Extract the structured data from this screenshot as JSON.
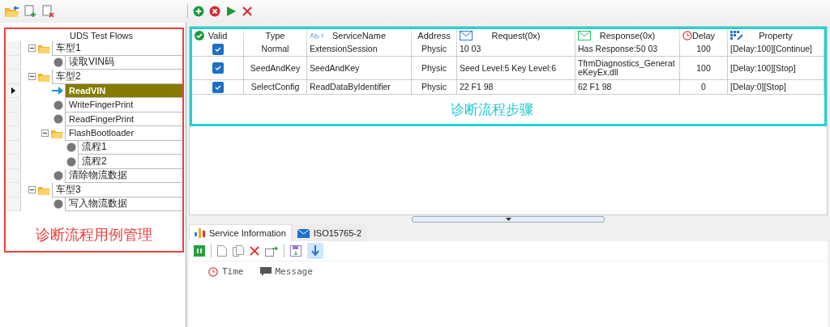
{
  "left_panel": {
    "tree": {
      "title": "UDS Test Flows",
      "nodes": [
        {
          "kind": "folder",
          "label": "车型1",
          "expanded": true,
          "selected": false,
          "children": [
            {
              "kind": "step",
              "label": "读取VIN码",
              "selected": false
            }
          ]
        },
        {
          "kind": "folder",
          "label": "车型2",
          "expanded": true,
          "selected": false,
          "children": [
            {
              "kind": "step",
              "label": "ReadVIN",
              "selected": true
            },
            {
              "kind": "step",
              "label": "WriteFingerPrint",
              "selected": false
            },
            {
              "kind": "step",
              "label": "ReadFingerPrint",
              "selected": false
            },
            {
              "kind": "folder",
              "label": "FlashBootloader",
              "expanded": true,
              "selected": false,
              "children": [
                {
                  "kind": "step",
                  "label": "流程1",
                  "selected": false
                },
                {
                  "kind": "step",
                  "label": "流程2",
                  "selected": false
                }
              ]
            },
            {
              "kind": "step",
              "label": "清除物流数据",
              "selected": false
            }
          ]
        },
        {
          "kind": "folder",
          "label": "车型3",
          "expanded": true,
          "selected": false,
          "children": [
            {
              "kind": "step",
              "label": "写入物流数据",
              "selected": false
            }
          ]
        }
      ]
    },
    "annotation": "诊断流程用例管理"
  },
  "steps_grid": {
    "columns": [
      "Valid",
      "Type",
      "ServiceName",
      "Address",
      "Request(0x)",
      "Response(0x)",
      "Delay",
      "Property"
    ],
    "rows": [
      {
        "valid": true,
        "type": "Normal",
        "service": "ExtensionSession",
        "address": "Physic",
        "request": "10 03",
        "response": "Has Response:50 03",
        "delay": "100",
        "property": "[Delay:100][Continue]"
      },
      {
        "valid": true,
        "type": "SeedAndKey",
        "service": "SeedAndKey",
        "address": "Physic",
        "request": "Seed Level:5 Key Level:6",
        "response": "TfrmDiagnostics_GenerateKeyEx.dll",
        "delay": "100",
        "property": "[Delay:100][Stop]"
      },
      {
        "valid": true,
        "type": "SelectConfig",
        "service": "ReadDataByIdentifier",
        "address": "Physic",
        "request": "22 F1 98",
        "response": "62 F1 98",
        "delay": "0",
        "property": "[Delay:0][Stop]"
      }
    ],
    "annotation": "诊断流程步骤"
  },
  "bottom_tabs": [
    {
      "label": "Service Information",
      "selected": true
    },
    {
      "label": "ISO15765-2",
      "selected": false
    }
  ],
  "log": {
    "columns": [
      "Time",
      "Message"
    ],
    "autoscroll": true
  }
}
